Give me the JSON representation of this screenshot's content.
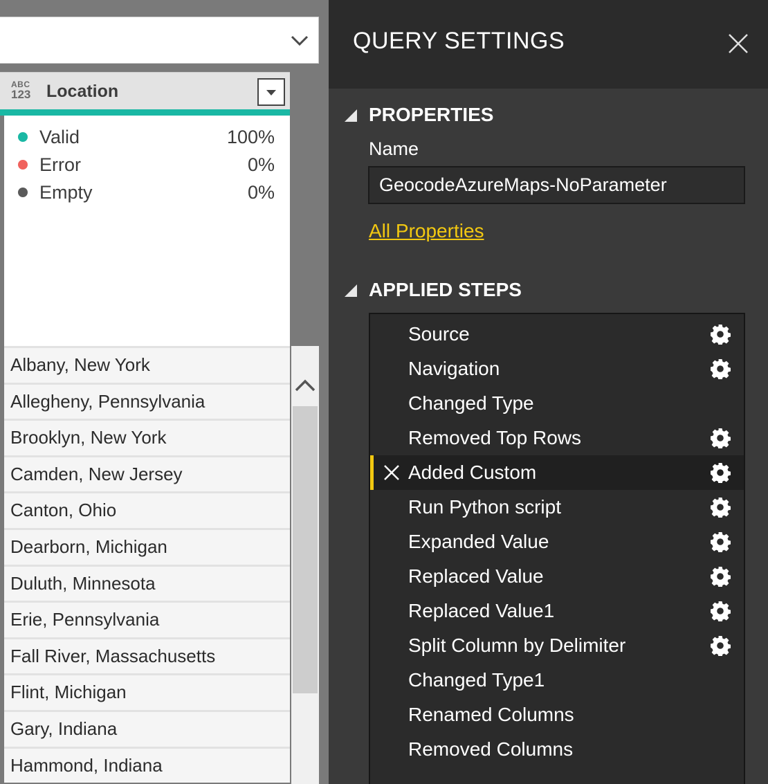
{
  "column": {
    "type_icon": {
      "top": "ABC",
      "bottom": "123"
    },
    "name": "Location"
  },
  "quality": [
    {
      "label": "Valid",
      "value": "100%",
      "color": "#1ab8a4"
    },
    {
      "label": "Error",
      "value": "0%",
      "color": "#f0625d"
    },
    {
      "label": "Empty",
      "value": "0%",
      "color": "#5a5a5a"
    }
  ],
  "rows": [
    "Albany, New York",
    "Allegheny, Pennsylvania",
    "Brooklyn, New York",
    "Camden, New Jersey",
    "Canton, Ohio",
    "Dearborn, Michigan",
    "Duluth, Minnesota",
    "Erie, Pennsylvania",
    "Fall River, Massachusetts",
    "Flint, Michigan",
    "Gary, Indiana",
    "Hammond, Indiana"
  ],
  "query_settings": {
    "title": "QUERY SETTINGS",
    "properties_label": "PROPERTIES",
    "name_label": "Name",
    "name_value": "GeocodeAzureMaps-NoParameter",
    "all_properties_label": "All Properties",
    "applied_steps_label": "APPLIED STEPS",
    "steps": [
      {
        "label": "Source",
        "gear": true,
        "active": false
      },
      {
        "label": "Navigation",
        "gear": true,
        "active": false
      },
      {
        "label": "Changed Type",
        "gear": false,
        "active": false
      },
      {
        "label": "Removed Top Rows",
        "gear": true,
        "active": false
      },
      {
        "label": "Added Custom",
        "gear": true,
        "active": true
      },
      {
        "label": "Run Python script",
        "gear": true,
        "active": false
      },
      {
        "label": "Expanded Value",
        "gear": true,
        "active": false
      },
      {
        "label": "Replaced Value",
        "gear": true,
        "active": false
      },
      {
        "label": "Replaced Value1",
        "gear": true,
        "active": false
      },
      {
        "label": "Split Column by Delimiter",
        "gear": true,
        "active": false
      },
      {
        "label": "Changed Type1",
        "gear": false,
        "active": false
      },
      {
        "label": "Renamed Columns",
        "gear": false,
        "active": false
      },
      {
        "label": "Removed Columns",
        "gear": false,
        "active": false
      }
    ]
  },
  "colors": {
    "accent": "#f2c811",
    "quality_bar": "#1ab8a4",
    "panel_bg": "#3a3a3a",
    "header_bg": "#2b2b2b"
  }
}
